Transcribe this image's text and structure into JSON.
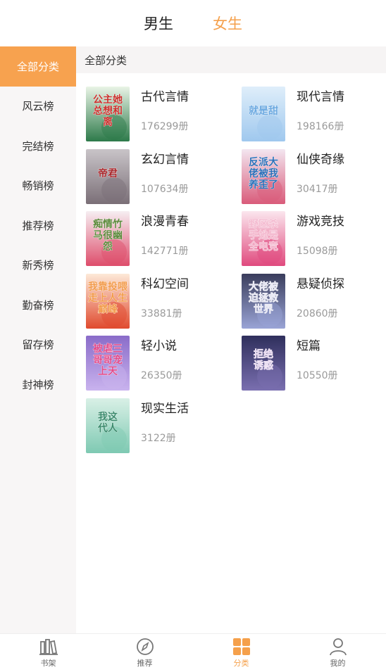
{
  "gender_tabs": [
    {
      "label": "男生",
      "active": false
    },
    {
      "label": "女生",
      "active": true
    }
  ],
  "sidebar": {
    "items": [
      {
        "label": "全部分类",
        "active": true
      },
      {
        "label": "风云榜"
      },
      {
        "label": "完结榜"
      },
      {
        "label": "畅销榜"
      },
      {
        "label": "推荐榜"
      },
      {
        "label": "新秀榜"
      },
      {
        "label": "勤奋榜"
      },
      {
        "label": "留存榜"
      },
      {
        "label": "封神榜"
      }
    ]
  },
  "section": {
    "title": "全部分类"
  },
  "categories": [
    {
      "name": "古代言情",
      "count": "176299册",
      "cover_text": "公主她总想和离",
      "colors": [
        "#e9f4e6",
        "#2d7a4a",
        "#c9302c"
      ]
    },
    {
      "name": "现代言情",
      "count": "198166册",
      "cover_text": "就是甜",
      "colors": [
        "#dfeefa",
        "#9fc8ee",
        "#6aa8e0"
      ]
    },
    {
      "name": "玄幻言情",
      "count": "107634册",
      "cover_text": "帝君",
      "colors": [
        "#c9c4c8",
        "#7b6f77",
        "#a8252a"
      ]
    },
    {
      "name": "仙侠奇缘",
      "count": "30417册",
      "cover_text": "反派大佬被我养歪了",
      "colors": [
        "#f3e6f0",
        "#d95b7a",
        "#2b6fb8"
      ]
    },
    {
      "name": "浪漫青春",
      "count": "142771册",
      "cover_text": "痴情竹马很幽怨",
      "colors": [
        "#f6eef2",
        "#de4d6b",
        "#5d8a3c"
      ]
    },
    {
      "name": "游戏竞技",
      "count": "15098册",
      "cover_text": "野区杀手她是全电竞",
      "colors": [
        "#fbe6ee",
        "#e04a7e",
        "#f4b9cf"
      ]
    },
    {
      "name": "科幻空间",
      "count": "33881册",
      "cover_text": "我靠投喂走上人生巅峰",
      "colors": [
        "#fde9d8",
        "#e04a2e",
        "#f29a4a"
      ]
    },
    {
      "name": "悬疑侦探",
      "count": "20860册",
      "cover_text": "大佬被迫拯救世界",
      "colors": [
        "#3a3d5c",
        "#9aa4d6",
        "#e8e8f4"
      ]
    },
    {
      "name": "轻小说",
      "count": "26350册",
      "cover_text": "被虐三哥哥宠上天",
      "colors": [
        "#8a6cc9",
        "#c9b3ee",
        "#e04a8a"
      ]
    },
    {
      "name": "短篇",
      "count": "10550册",
      "cover_text": "拒绝诱惑",
      "colors": [
        "#2f2f5c",
        "#7a6fb0",
        "#e8d9f0"
      ]
    },
    {
      "name": "现实生活",
      "count": "3122册",
      "cover_text": "我这代人",
      "colors": [
        "#d9f0e6",
        "#7ec9b2",
        "#3a8a6c"
      ]
    }
  ],
  "tabbar": [
    {
      "label": "书架",
      "icon": "bookshelf-icon",
      "active": false
    },
    {
      "label": "推荐",
      "icon": "compass-icon",
      "active": false
    },
    {
      "label": "分类",
      "icon": "grid-icon",
      "active": true
    },
    {
      "label": "我的",
      "icon": "user-icon",
      "active": false
    }
  ],
  "colors": {
    "accent": "#f5a04b",
    "sidebar_bg": "#f8f6f6",
    "header_bg": "#f6f4f4"
  }
}
